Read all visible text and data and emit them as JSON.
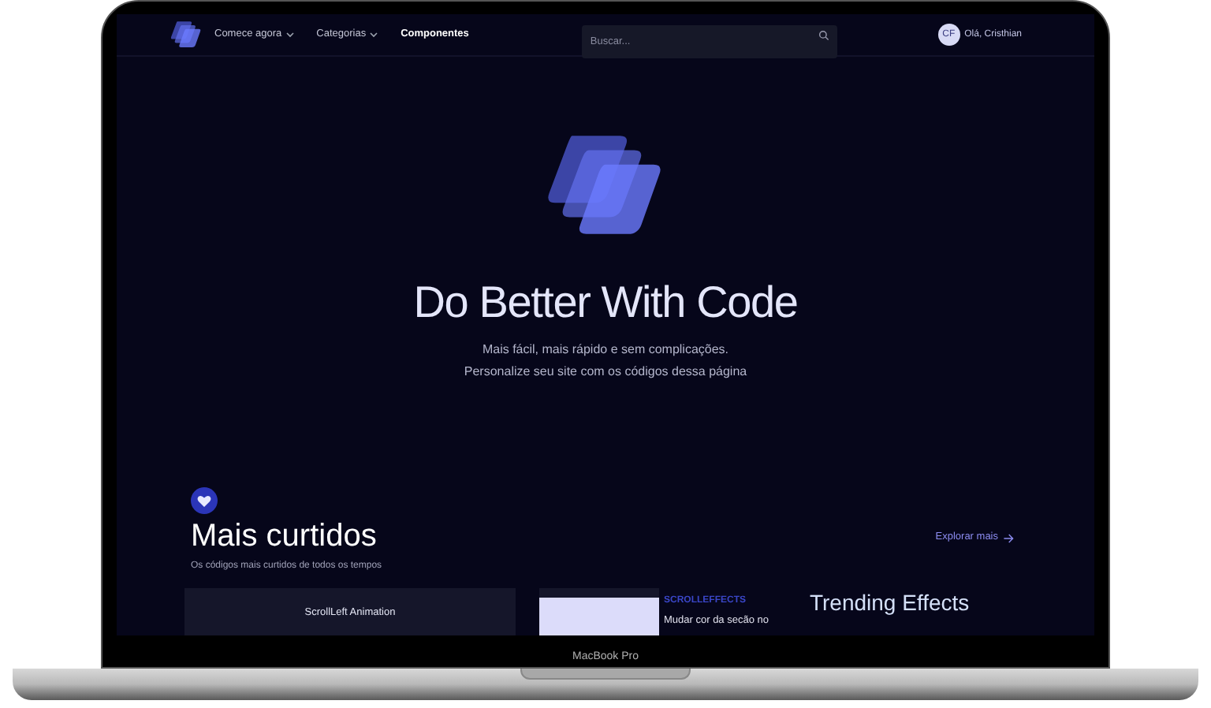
{
  "nav": {
    "items": [
      {
        "label": "Comece agora",
        "dropdown": true
      },
      {
        "label": "Categorias",
        "dropdown": true
      },
      {
        "label": "Componentes",
        "dropdown": false
      }
    ],
    "search": {
      "placeholder": "Buscar..."
    },
    "user": {
      "initials": "CF",
      "greeting": "Olá, Cristhian"
    }
  },
  "hero": {
    "title": "Do Better With Code",
    "subtitle_lines": [
      "Mais fácil, mais rápido e sem complicações.",
      "Personalize seu site com os códigos dessa página"
    ]
  },
  "section": {
    "title": "Mais curtidos",
    "subtitle": "Os códigos mais curtidos de todos os tempos",
    "link": "Explorar mais"
  },
  "cards": [
    {
      "title": "ScrollLeft Animation"
    }
  ],
  "feature": {
    "category": "SCROLLEFFECTS",
    "description": "Mudar cor da secão no"
  },
  "trending": {
    "title": "Trending Effects"
  },
  "device": {
    "label": "MacBook Pro"
  }
}
